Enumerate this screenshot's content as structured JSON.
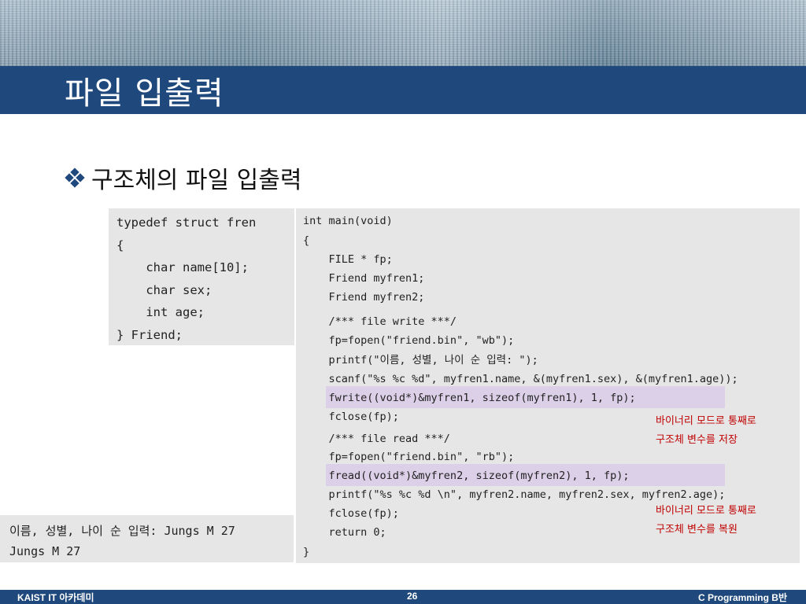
{
  "header": {
    "title": "파일 입출력"
  },
  "bullet": {
    "text": "구조체의 파일 입출력",
    "icon": "four-diamond-bullet-icon"
  },
  "struct_code": [
    "typedef struct fren",
    "{",
    "    char name[10];",
    "    char sex;",
    "    int age;",
    "} Friend;"
  ],
  "main_code": [
    "int main(void)",
    "{",
    "    FILE * fp;",
    "    Friend myfren1;",
    "    Friend myfren2;",
    "    /*** file write ***/",
    "    fp=fopen(\"friend.bin\", \"wb\");",
    "    printf(\"이름, 성별, 나이 순 입력: \");",
    "    scanf(\"%s %c %d\", myfren1.name, &(myfren1.sex), &(myfren1.age));",
    "    fwrite((void*)&myfren1, sizeof(myfren1), 1, fp);",
    "    fclose(fp);",
    "    /*** file read ***/",
    "    fp=fopen(\"friend.bin\", \"rb\");",
    "    fread((void*)&myfren2, sizeof(myfren2), 1, fp);",
    "    printf(\"%s %c %d \\n\", myfren2.name, myfren2.sex, myfren2.age);",
    "    fclose(fp);",
    "    return 0;",
    "}"
  ],
  "notes": {
    "write": [
      "바이너리 모드로 통째로",
      "구조체 변수를 저장"
    ],
    "read": [
      "바이너리 모드로 통째로",
      "구조체 변수를 복원"
    ]
  },
  "console": [
    "이름, 성별, 나이 순 입력: Jungs M 27",
    "Jungs M 27"
  ],
  "footer": {
    "left": "KAIST IT 아카데미",
    "page_number": "26",
    "right": "C Programming B반"
  },
  "colors": {
    "title_bar": "#1f497d",
    "code_background": "#e6e6e6",
    "highlight": "#dcd0e8",
    "note_text": "#c00000"
  }
}
